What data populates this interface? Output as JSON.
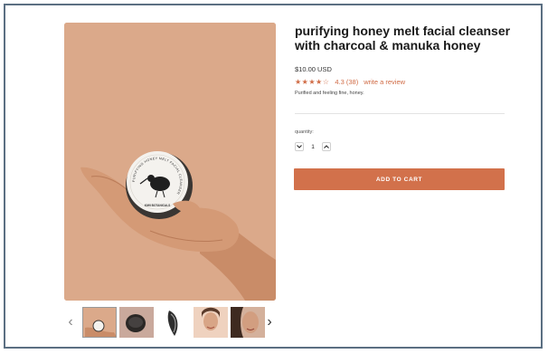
{
  "product": {
    "title": "purifying honey melt facial cleanser with charcoal & manuka honey",
    "price": "$10.00 USD",
    "stars": "★★★★☆",
    "rating": "4.3 (38)",
    "review_link": "write a review",
    "rating_value": 4.3,
    "review_count": 38,
    "description": "Purified and feeling fine, honey."
  },
  "jar_label": {
    "ring_text": "PURIFYING HONEY MELT FACIAL CLEANSER",
    "brand": "KIWI BOTANICALS"
  },
  "quantity": {
    "label": "quantity:",
    "value": "1",
    "decrease_icon": "chevron-down-icon",
    "increase_icon": "chevron-up-icon"
  },
  "cart": {
    "button_label": "ADD TO CART"
  },
  "gallery": {
    "prev_icon": "‹",
    "next_icon": "›",
    "thumbnail_count": 5
  },
  "colors": {
    "accent": "#d2714b",
    "image_background": "#dba98a",
    "frame_border": "#5b6f82"
  }
}
